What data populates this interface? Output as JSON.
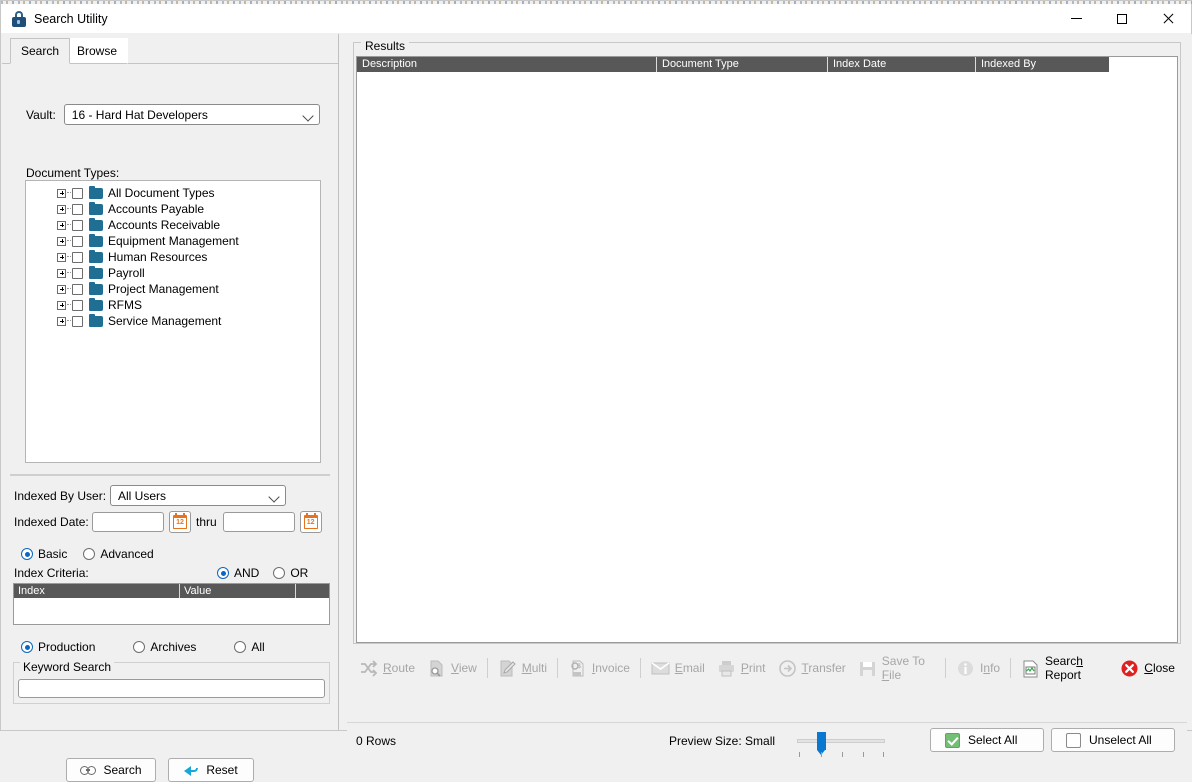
{
  "window": {
    "title": "Search Utility",
    "icon": "lock-icon",
    "minimize": "—",
    "maximize": "□",
    "close": "✕"
  },
  "tabs": [
    {
      "label": "Search",
      "active": true
    },
    {
      "label": "Browse",
      "active": false
    }
  ],
  "search_panel": {
    "vault_label": "Vault:",
    "vault_value": "16 - Hard Hat Developers",
    "document_types_label": "Document Types:",
    "tree_items": [
      {
        "label": "All Document Types",
        "checked": false,
        "expandable": true
      },
      {
        "label": "Accounts Payable",
        "checked": false,
        "expandable": true
      },
      {
        "label": "Accounts Receivable",
        "checked": false,
        "expandable": true
      },
      {
        "label": "Equipment Management",
        "checked": false,
        "expandable": true
      },
      {
        "label": "Human Resources",
        "checked": false,
        "expandable": true
      },
      {
        "label": "Payroll",
        "checked": false,
        "expandable": true
      },
      {
        "label": "Project Management",
        "checked": false,
        "expandable": true
      },
      {
        "label": "RFMS",
        "checked": false,
        "expandable": true
      },
      {
        "label": "Service Management",
        "checked": false,
        "expandable": true
      }
    ],
    "indexed_by_user_label": "Indexed By User:",
    "indexed_by_user_value": "All Users",
    "indexed_date_label": "Indexed Date:",
    "indexed_date_from": "",
    "indexed_date_to": "",
    "indexed_date_from_placeholder": "",
    "indexed_date_to_placeholder": "",
    "thru_label": "thru",
    "calendar_icon_text": "12",
    "mode_basic": "Basic",
    "mode_advanced": "Advanced",
    "mode_selected": "Basic",
    "index_criteria_label": "Index Criteria:",
    "operator_and": "AND",
    "operator_or": "OR",
    "operator_selected": "AND",
    "criteria_columns": [
      "Index",
      "Value"
    ],
    "criteria_rows": [],
    "scope_production": "Production",
    "scope_archives": "Archives",
    "scope_all": "All",
    "scope_selected": "Production",
    "keyword_search_label": "Keyword Search",
    "keyword_value": "",
    "keyword_placeholder": "",
    "search_button": "Search",
    "reset_button": "Reset"
  },
  "results": {
    "legend": "Results",
    "columns": [
      "Description",
      "Document Type",
      "Index Date",
      "Indexed By"
    ],
    "rows": []
  },
  "toolbar": {
    "items": [
      {
        "name": "route",
        "label": "Route",
        "icon": "shuffle-icon",
        "enabled": false
      },
      {
        "name": "view",
        "label": "View",
        "icon": "document-search-icon",
        "enabled": false
      },
      {
        "name": "multi",
        "label": "Multi",
        "icon": "multi-edit-icon",
        "enabled": false
      },
      {
        "name": "invoice",
        "label": "Invoice",
        "icon": "invoice-icon",
        "enabled": false
      },
      {
        "name": "email",
        "label": "Email",
        "icon": "envelope-icon",
        "enabled": false
      },
      {
        "name": "print",
        "label": "Print",
        "icon": "printer-icon",
        "enabled": false
      },
      {
        "name": "transfer",
        "label": "Transfer",
        "icon": "arrow-circle-icon",
        "enabled": false
      },
      {
        "name": "save-to-file",
        "label": "Save To File",
        "icon": "floppy-icon",
        "enabled": false
      },
      {
        "name": "info",
        "label": "Info",
        "icon": "info-icon",
        "enabled": false
      },
      {
        "name": "search-report",
        "label": "Search Report",
        "icon": "report-chart-icon",
        "enabled": true
      },
      {
        "name": "close",
        "label": "Close",
        "icon": "red-x-icon",
        "enabled": true
      }
    ]
  },
  "status": {
    "rows_text": "0 Rows",
    "preview_size_text": "Preview Size: Small",
    "select_all": "Select All",
    "unselect_all": "Unselect All"
  },
  "colors": {
    "accent_blue": "#0a66c2",
    "folder_blue": "#1f6f94",
    "calendar_orange": "#e8731e",
    "grid_header": "#585858",
    "close_red": "#e02020",
    "check_green": "#73bf73",
    "slider_blue": "#0a78d1",
    "reset_cyan": "#19a7d8"
  }
}
